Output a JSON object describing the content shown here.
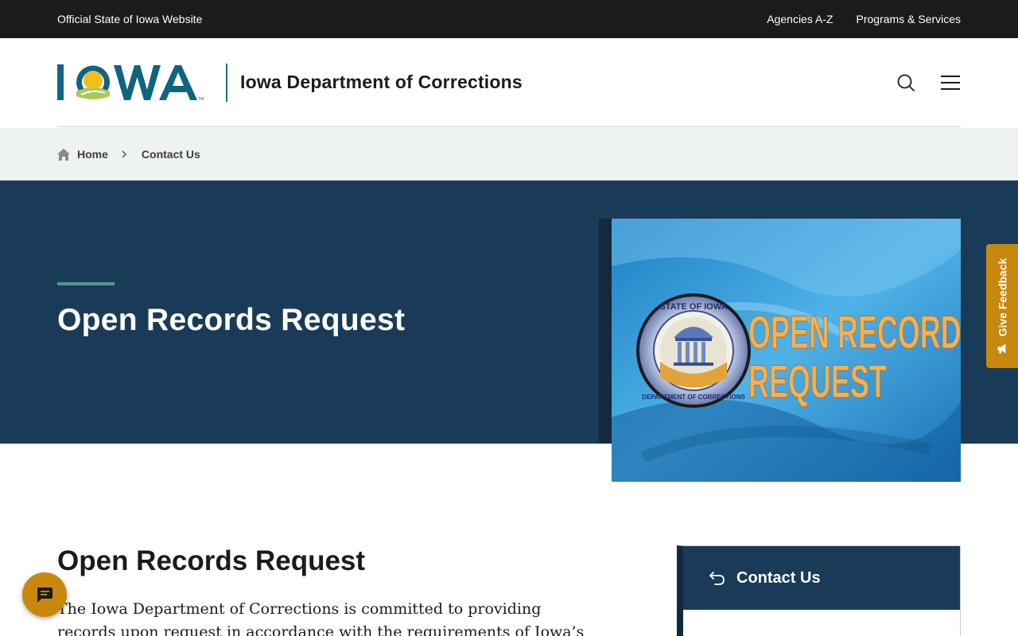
{
  "topbar": {
    "official_label": "Official State of Iowa Website",
    "links": [
      "Agencies A-Z",
      "Programs & Services"
    ]
  },
  "header": {
    "logo_text": "IOWA",
    "department_name": "Iowa Department of Corrections",
    "search_icon": "search-icon",
    "menu_icon": "hamburger-menu-icon"
  },
  "breadcrumb": {
    "home_label": "Home",
    "current_label": "Contact Us"
  },
  "hero": {
    "title": "Open Records Request",
    "image": {
      "seal_top_text": "STATE OF IOWA",
      "seal_bottom_text": "DEPARTMENT OF CORRECTIONS",
      "headline_line1": "OPEN RECORDS",
      "headline_line2": "REQUEST"
    }
  },
  "feedback": {
    "label": "Give Feedback"
  },
  "content": {
    "title": "Open Records Request",
    "paragraph": "The Iowa Department of Corrections is committed to providing records upon request in accordance with the requirements of Iowa’s open records law."
  },
  "sidebar": {
    "contact_title": "Contact Us"
  },
  "colors": {
    "topbar_bg": "#1b1b1b",
    "hero_bg": "#1a3b58",
    "accent_teal": "#4e9a8e",
    "feedback_gold": "#c8880e",
    "breadcrumb_bg": "#eff2f3"
  }
}
